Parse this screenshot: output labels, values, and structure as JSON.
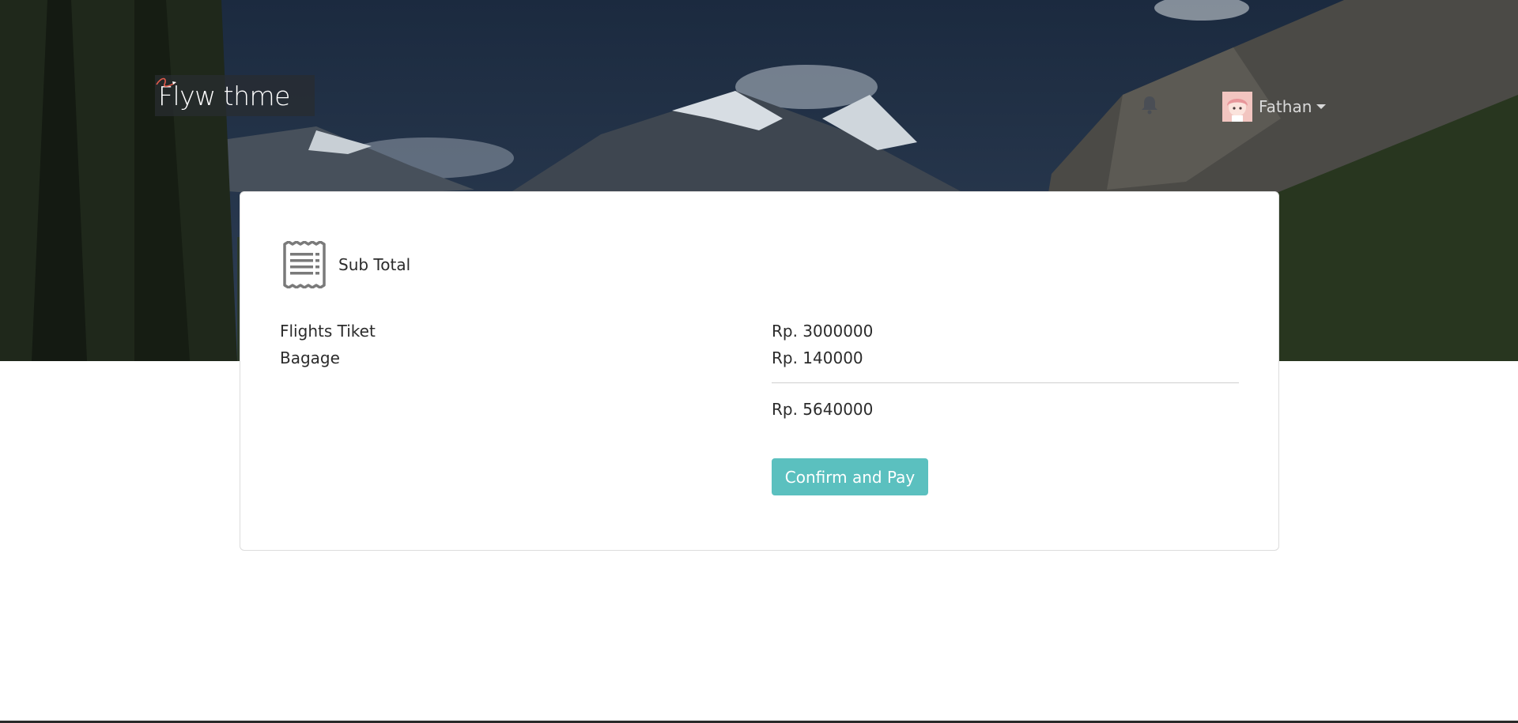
{
  "header": {
    "logo_text": "Flyw thme",
    "notifications_icon": "bell-icon",
    "user": {
      "name": "Fathan",
      "avatar_icon": "avatar-icon",
      "menu_icon": "chevron-down-icon"
    }
  },
  "summary": {
    "icon": "receipt-icon",
    "title": "Sub Total",
    "items": [
      {
        "label": "Flights Tiket",
        "value": "Rp. 3000000"
      },
      {
        "label": "Bagage",
        "value": "Rp. 140000"
      }
    ],
    "total": "Rp. 5640000",
    "confirm_label": "Confirm and Pay"
  },
  "colors": {
    "accent": "#5bc0bf",
    "text": "#2b2b2b",
    "border": "#dcdcdc"
  }
}
